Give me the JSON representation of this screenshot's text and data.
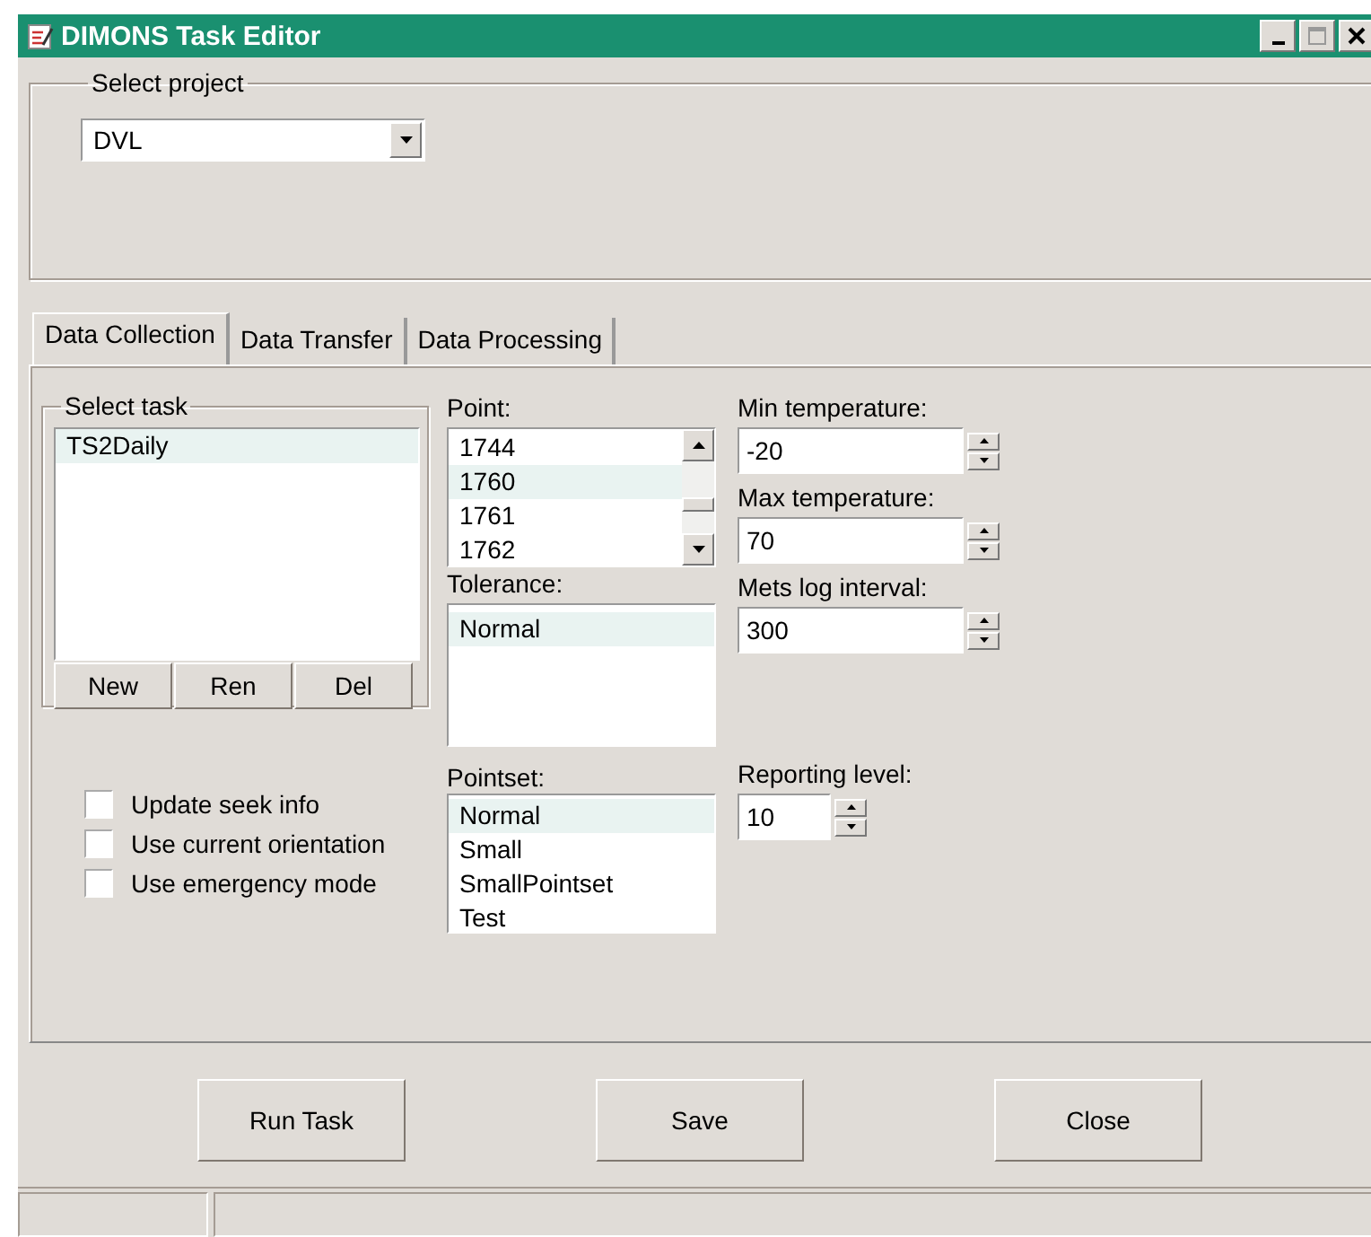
{
  "window": {
    "title": "DIMONS Task Editor"
  },
  "project": {
    "label": "Select project",
    "value": "DVL"
  },
  "tabs": [
    {
      "label": "Data Collection",
      "selected": true
    },
    {
      "label": "Data Transfer",
      "selected": false
    },
    {
      "label": "Data Processing",
      "selected": false
    }
  ],
  "task_group": {
    "label": "Select task",
    "items": [
      {
        "label": "TS2Daily",
        "selected": true
      }
    ],
    "buttons": [
      "New",
      "Ren",
      "Del"
    ]
  },
  "checkboxes": [
    {
      "label": "Update seek info",
      "checked": false
    },
    {
      "label": "Use current orientation",
      "checked": false
    },
    {
      "label": "Use emergency mode",
      "checked": false
    }
  ],
  "point": {
    "label": "Point:",
    "items": [
      {
        "label": "1744",
        "selected": false
      },
      {
        "label": "1760",
        "selected": true
      },
      {
        "label": "1761",
        "selected": false
      },
      {
        "label": "1762",
        "selected": false
      }
    ]
  },
  "tolerance": {
    "label": "Tolerance:",
    "items": [
      {
        "label": "Normal",
        "selected": true
      }
    ]
  },
  "pointset": {
    "label": "Pointset:",
    "items": [
      {
        "label": "Normal",
        "selected": true
      },
      {
        "label": "Small",
        "selected": false
      },
      {
        "label": "SmallPointset",
        "selected": false
      },
      {
        "label": "Test",
        "selected": false
      }
    ]
  },
  "spinners": [
    {
      "label": "Min temperature:",
      "value": "-20"
    },
    {
      "label": "Max temperature:",
      "value": "70"
    },
    {
      "label": "Mets log interval:",
      "value": "300"
    },
    {
      "label": "Reporting level:",
      "value": "10"
    }
  ],
  "buttons": [
    "Run Task",
    "Save",
    "Close"
  ]
}
